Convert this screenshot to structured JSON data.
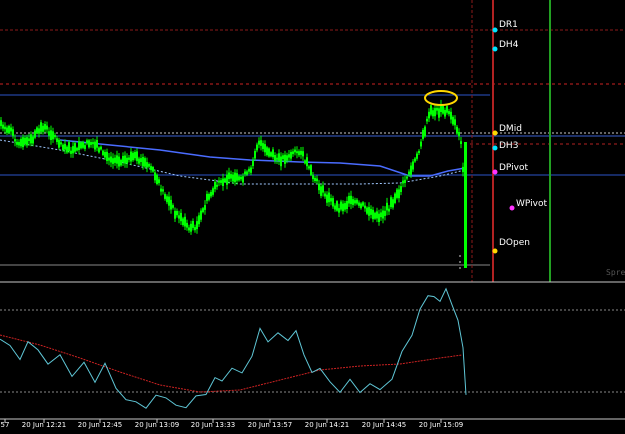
{
  "chart_data": {
    "type": "candlestick",
    "x_tick_labels": [
      "57",
      "20 Jun 12:21",
      "20 Jun 12:45",
      "20 Jun 13:09",
      "20 Jun 13:33",
      "20 Jun 13:57",
      "20 Jun 14:21",
      "20 Jun 14:45",
      "20 Jun 15:09"
    ],
    "level_labels": {
      "dr1": "DR1",
      "dh4": "DH4",
      "dmid": "DMid",
      "dh3": "DH3",
      "dpivot": "DPivot",
      "wpivot": "WPivot",
      "dopen": "DOpen"
    },
    "watermark": "Spre",
    "colors": {
      "background": "#000000",
      "candles": "#00ff00",
      "ma_fast": "#4a6cff",
      "ma_slow": "#a0c8ff",
      "oscillator_line": "#5fc6d6",
      "oscillator_signal": "#cc2222",
      "highlight_ellipse": "#ffd700",
      "current_price_line": "#ffffff",
      "level_marker_cyan": "#00e5ff",
      "level_marker_yellow": "#ffd700",
      "level_marker_magenta": "#ff33ff",
      "vertical_red": "#b22222",
      "vertical_green": "#22a022"
    },
    "grid": false,
    "legend": "none"
  }
}
